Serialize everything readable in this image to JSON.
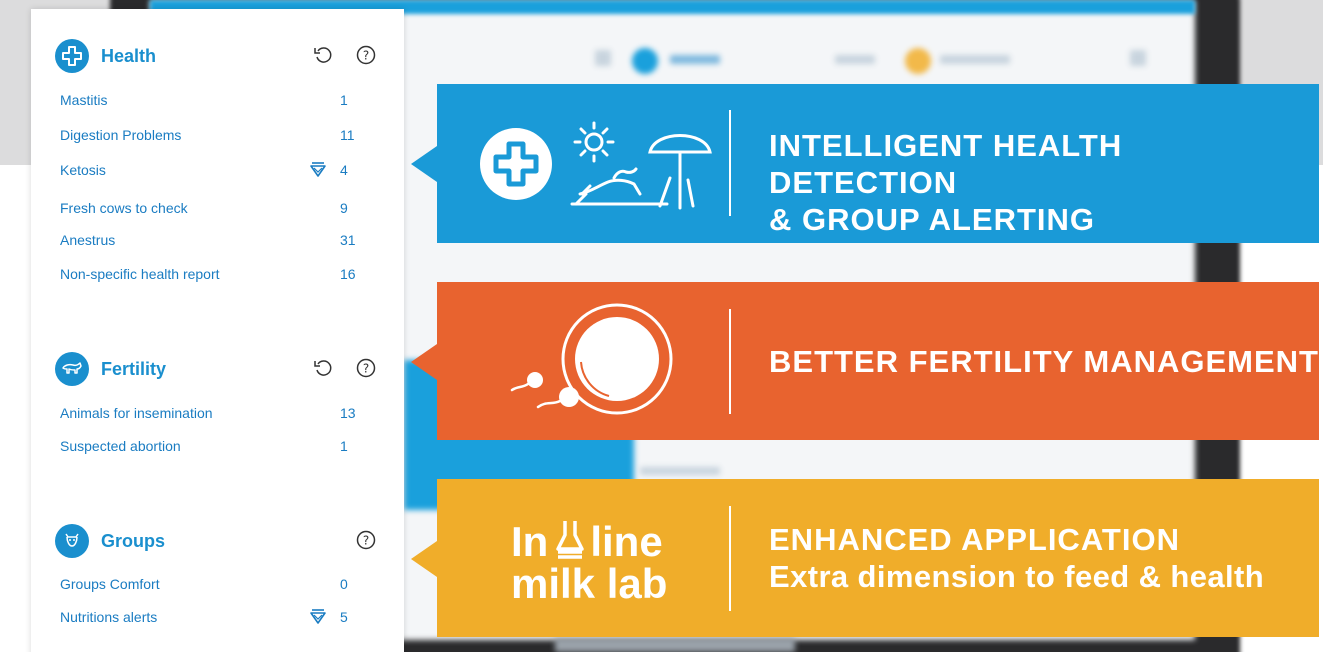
{
  "panel": {
    "health": {
      "title": "Health",
      "icon": "plus-cross-icon",
      "items": [
        {
          "label": "Mastitis",
          "count": "1"
        },
        {
          "label": "Digestion Problems",
          "count": "11"
        },
        {
          "label": "Ketosis",
          "count": "4",
          "flag": "alert-gem-icon"
        },
        {
          "label": "Fresh cows to check",
          "count": "9"
        },
        {
          "label": "Anestrus",
          "count": "31"
        },
        {
          "label": "Non-specific health report",
          "count": "16"
        }
      ]
    },
    "fertility": {
      "title": "Fertility",
      "icon": "cow-icon",
      "items": [
        {
          "label": "Animals for insemination",
          "count": "13"
        },
        {
          "label": "Suspected abortion",
          "count": "1"
        }
      ]
    },
    "groups": {
      "title": "Groups",
      "icon": "cow-group-icon",
      "items": [
        {
          "label": "Groups Comfort",
          "count": "0"
        },
        {
          "label": "Nutritions alerts",
          "count": "5",
          "flag": "alert-gem-icon"
        }
      ]
    }
  },
  "banners": {
    "health": {
      "line1": "INTELLIGENT HEALTH DETECTION",
      "line2": "& GROUP ALERTING",
      "color": "#1a9ad7"
    },
    "fertility": {
      "line1": "BETTER FERTILITY MANAGEMENT",
      "color": "#e8632f"
    },
    "inline": {
      "line1": "ENHANCED APPLICATION",
      "line2": "Extra dimension to feed & health",
      "logo_line1_a": "In",
      "logo_line1_b": "line",
      "logo_line2": "milk lab",
      "color": "#f0ad2a"
    }
  },
  "colors": {
    "accent": "#1a8fce",
    "link": "#1a7cc2"
  }
}
